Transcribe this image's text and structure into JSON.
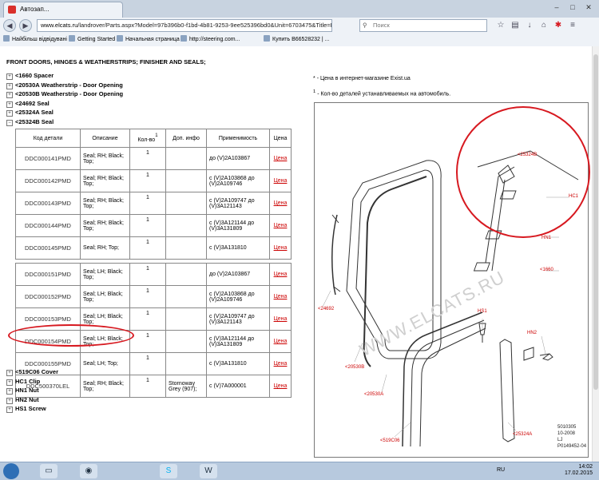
{
  "browser": {
    "tab_title": "Автозап...",
    "url_host": "www.elcats.ru",
    "url_rest": "/landrover/Parts.aspx?Model=97b396b0-f1bd-4b81-9253-9ee525396bd0&Unit=6703475&Title=FRONT+DOORS%2C+",
    "search_placeholder": "Поиск",
    "bookmarks": [
      "Найбільш відвідувані",
      "Getting Started",
      "Начальная страница",
      "http://steering.com...",
      "Купить B66528232 | ..."
    ]
  },
  "page": {
    "title": "FRONT DOORS, HINGES & WEATHERSTRIPS; FINISHER AND SEALS;",
    "tree_top": [
      {
        "mark": "+",
        "label": "<1660  Spacer"
      },
      {
        "mark": "+",
        "label": "<20530A  Weatherstrip - Door Opening"
      },
      {
        "mark": "+",
        "label": "<20530B  Weatherstrip - Door Opening"
      },
      {
        "mark": "+",
        "label": "<24692  Seal"
      },
      {
        "mark": "+",
        "label": "<25324A  Seal"
      },
      {
        "mark": "−",
        "label": "<25324B  Seal"
      }
    ],
    "table": {
      "headers": [
        "Код детали",
        "Описание",
        "Кол-во",
        "1",
        "Доп. инфо",
        "Применимость",
        "Цена"
      ],
      "rows": [
        {
          "code": "DDC000141PMD",
          "desc": "Seal; RH; Black; Top;",
          "qty": "1",
          "dop": "",
          "prim": "до (V)2A103867",
          "price": "Цена"
        },
        {
          "code": "DDC000142PMD",
          "desc": "Seal; RH; Black; Top;",
          "qty": "1",
          "dop": "",
          "prim": "с (V)2A103868 до (V)2A109746",
          "price": "Цена"
        },
        {
          "code": "DDC000143PMD",
          "desc": "Seal; RH; Black; Top;",
          "qty": "1",
          "dop": "",
          "prim": "с (V)2A109747 до (V)3A121143",
          "price": "Цена"
        },
        {
          "code": "DDC000144PMD",
          "desc": "Seal; RH; Black; Top;",
          "qty": "1",
          "dop": "",
          "prim": "с (V)3A121144 до (V)3A131809",
          "price": "Цена"
        },
        {
          "code": "DDC000145PMD",
          "desc": "Seal; RH; Top;",
          "qty": "1",
          "dop": "",
          "prim": "с (V)3A131810",
          "price": "Цена"
        },
        {
          "code": "DDC000151PMD",
          "desc": "Seal; LH; Black; Top;",
          "qty": "1",
          "dop": "",
          "prim": "до (V)2A103867",
          "price": "Цена"
        },
        {
          "code": "DDC000152PMD",
          "desc": "Seal; LH; Black; Top;",
          "qty": "1",
          "dop": "",
          "prim": "с (V)2A103868 до (V)2A109746",
          "price": "Цена"
        },
        {
          "code": "DDC000153PMD",
          "desc": "Seal; LH; Black; Top;",
          "qty": "1",
          "dop": "",
          "prim": "с (V)2A109747 до (V)3A121143",
          "price": "Цена"
        },
        {
          "code": "DDC000154PMD",
          "desc": "Seal; LH; Black; Top;",
          "qty": "1",
          "dop": "",
          "prim": "с (V)3A121144 до (V)3A131809",
          "price": "Цена"
        },
        {
          "code": "DDC000155PMD",
          "desc": "Seal; LH; Top;",
          "qty": "1",
          "dop": "",
          "prim": "с (V)3A131810",
          "price": "Цена"
        },
        {
          "code": "DDC500370LEL",
          "desc": "Seal; RH; Black; Top;",
          "qty": "1",
          "dop": "Stornoway Grey (907);",
          "prim": "с (V)7A000001",
          "price": "Цена"
        }
      ]
    },
    "tree_bottom": [
      {
        "mark": "+",
        "label": "<519C06  Cover"
      },
      {
        "mark": "+",
        "label": "HC1  Clip"
      },
      {
        "mark": "+",
        "label": "HN1  Nut"
      },
      {
        "mark": "+",
        "label": "HN2  Nut"
      },
      {
        "mark": "+",
        "label": "HS1  Screw"
      }
    ],
    "notes": [
      {
        "sym": "*",
        "text": "- Цена в интернет-магазине Exist.ua"
      },
      {
        "sym": "1",
        "text": "- Кол-во деталей устанавливаемых на автомобиль."
      }
    ],
    "diagram": {
      "labels": [
        "<24692",
        "<20530B",
        "<20530A",
        "HS1",
        "HN2",
        "<519C06",
        "<25324A",
        "HC1",
        "HN1",
        "<1660",
        "<25324B"
      ],
      "watermark": "WWW.ELCATS.RU",
      "ref_lines": [
        "5010305",
        "10-2008",
        "LJ",
        "P0149452-04"
      ]
    }
  },
  "taskbar": {
    "lang": "RU",
    "time": "14:02",
    "date": "17.02.2015"
  },
  "colors": {
    "accent": "#d71920",
    "price_link": "#cc0000"
  }
}
